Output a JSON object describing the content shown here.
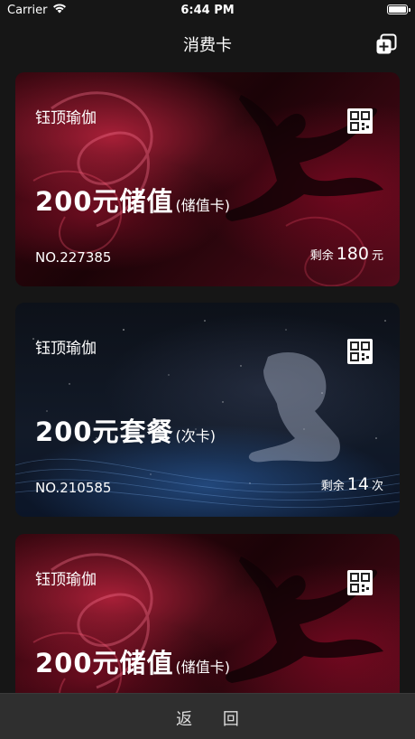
{
  "status_bar": {
    "carrier": "Carrier",
    "time": "6:44 PM"
  },
  "nav": {
    "title": "消费卡",
    "add_icon": "add-card-icon"
  },
  "cards": [
    {
      "name": "钰顶瑜伽",
      "title": "200元储值",
      "type": "(储值卡)",
      "number": "NO.227385",
      "remaining_prefix": "剩余",
      "remaining_value": "180",
      "remaining_unit": "元",
      "theme": "red"
    },
    {
      "name": "钰顶瑜伽",
      "title": "200元套餐",
      "type": "(次卡)",
      "number": "NO.210585",
      "remaining_prefix": "剩余",
      "remaining_value": "14",
      "remaining_unit": "次",
      "theme": "dark"
    },
    {
      "name": "钰顶瑜伽",
      "title": "200元储值",
      "type": "(储值卡)",
      "number": "",
      "remaining_prefix": "",
      "remaining_value": "",
      "remaining_unit": "",
      "theme": "red"
    }
  ],
  "footer": {
    "back_label": "返 回"
  },
  "colors": {
    "background": "#161616",
    "bottom_bar": "#2f2f2f",
    "card_red": "#520b1a",
    "card_dark": "#121a28"
  }
}
